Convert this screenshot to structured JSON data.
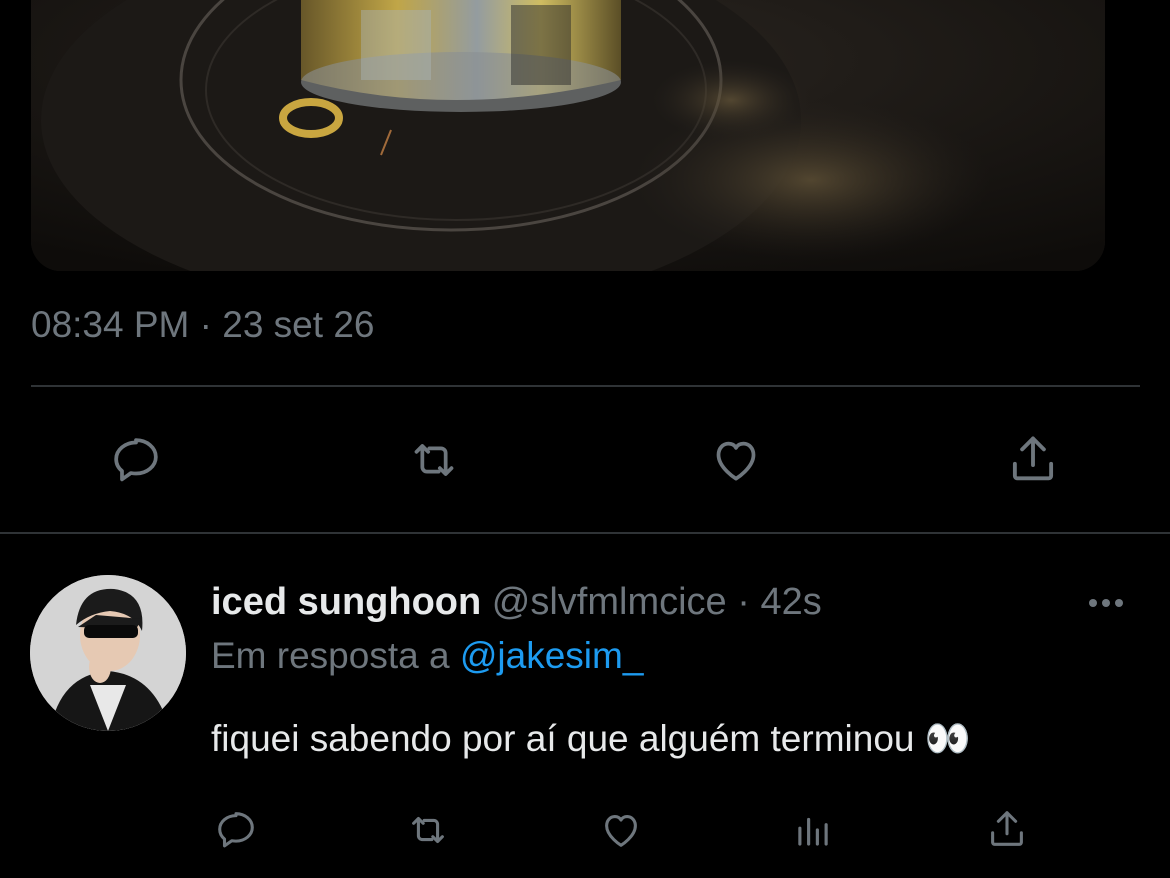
{
  "tweet": {
    "timestamp": "08:34 PM · 23 set 26",
    "media_alt": "drink-photo"
  },
  "reply": {
    "display_name": "iced sunghoon",
    "handle": "@slvfmlmcice",
    "separator": "·",
    "time_ago": "42s",
    "replying_prefix": "Em resposta a",
    "replying_to": "@jakesim_",
    "text": "fiquei sabendo por aí que alguém terminou 👀"
  },
  "colors": {
    "background": "#000000",
    "muted": "#6e767d",
    "link": "#1d9bf0",
    "divider": "#2f3336",
    "text": "#e7e9ea"
  },
  "icons": {
    "reply": "comment-icon",
    "retweet": "retweet-icon",
    "like": "heart-icon",
    "views": "analytics-icon",
    "share": "share-icon",
    "more": "more-icon"
  }
}
